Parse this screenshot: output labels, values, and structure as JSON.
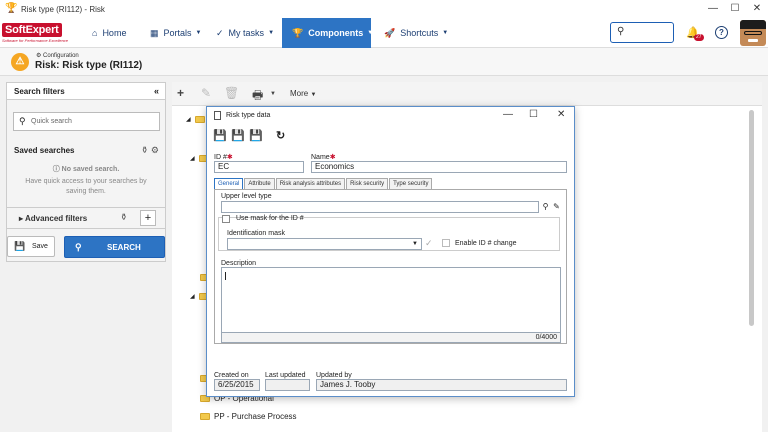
{
  "window": {
    "title": "Risk type (RI112) - Risk"
  },
  "nav": {
    "logo_brand": "SoftExpert",
    "logo_tagline": "Software for Performance Excellence",
    "items": [
      {
        "label": "Home",
        "icon": "home-icon"
      },
      {
        "label": "Portals",
        "icon": "grid-icon"
      },
      {
        "label": "My tasks",
        "icon": "check-icon"
      },
      {
        "label": "Components",
        "icon": "trophy-icon"
      },
      {
        "label": "Shortcuts",
        "icon": "rocket-icon"
      }
    ],
    "search_placeholder": "",
    "notifications_badge": "27"
  },
  "header": {
    "breadcrumb": "Configuration",
    "title": "Risk: Risk type (RI112)"
  },
  "left_panel": {
    "title": "Search filters",
    "quick_search_placeholder": "Quick search",
    "saved_searches_title": "Saved searches",
    "no_saved": "No saved search.",
    "no_saved_desc": "Have quick access to your searches by saving them.",
    "advanced_filters": "Advanced filters",
    "save_label": "Save",
    "search_label": "SEARCH"
  },
  "toolbar": {
    "more_label": "More"
  },
  "tree": {
    "root_fragment": "R",
    "items": [
      {
        "label": "OP - Operational"
      },
      {
        "label": "PP - Purchase Process"
      }
    ]
  },
  "dialog": {
    "title": "Risk type data",
    "id_label": "ID #",
    "id_value": "EC",
    "name_label": "Name",
    "name_value": "Economics",
    "tabs": [
      "General",
      "Attribute",
      "Risk analysis attributes",
      "Risk security",
      "Type security"
    ],
    "upper_level_label": "Upper level type",
    "upper_level_value": "",
    "use_mask_label": "Use mask for the ID #",
    "identification_mask_label": "Identification mask",
    "enable_id_change_label": "Enable ID # change",
    "description_label": "Description",
    "description_value": "",
    "char_counter": "0/4000",
    "created_on_label": "Created on",
    "created_on_value": "6/25/2015",
    "last_updated_label": "Last updated",
    "last_updated_value": "",
    "updated_by_label": "Updated by",
    "updated_by_value": "James J. Tooby"
  }
}
